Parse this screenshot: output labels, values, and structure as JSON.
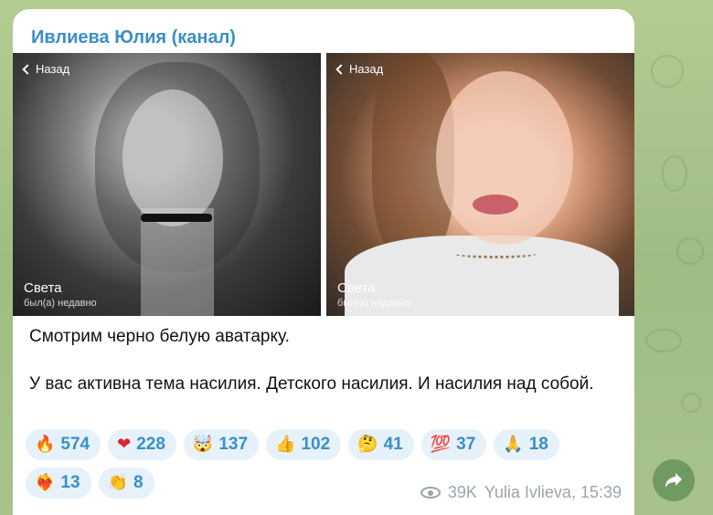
{
  "channel": {
    "name": "Ивлиева Юлия (канал)"
  },
  "photos": [
    {
      "back_label": "Назад",
      "contact_name": "Света",
      "contact_status": "был(а) недавно"
    },
    {
      "back_label": "Назад",
      "contact_name": "Света",
      "contact_status": "был(а) недавно"
    }
  ],
  "message": {
    "paragraphs": [
      "Смотрим черно белую аватарку.",
      "У вас активна тема насилия. Детского насилия. И насилия над собой."
    ]
  },
  "reactions": [
    {
      "emoji": "🔥",
      "icon": "fire-icon",
      "count": "574"
    },
    {
      "emoji": "❤",
      "icon": "heart-icon",
      "count": "228"
    },
    {
      "emoji": "🤯",
      "icon": "exploding-head-icon",
      "count": "137"
    },
    {
      "emoji": "👍",
      "icon": "thumbs-up-icon",
      "count": "102"
    },
    {
      "emoji": "🤔",
      "icon": "thinking-face-icon",
      "count": "41"
    },
    {
      "emoji": "💯",
      "icon": "hundred-icon",
      "count": "37"
    },
    {
      "emoji": "🙏",
      "icon": "folded-hands-icon",
      "count": "18"
    },
    {
      "emoji": "❤‍🔥",
      "icon": "heart-on-fire-icon",
      "count": "13"
    },
    {
      "emoji": "👏",
      "icon": "clapping-hands-icon",
      "count": "8"
    }
  ],
  "meta": {
    "views": "39K",
    "author_time": "Yulia Ivlieva, 15:39"
  },
  "colors": {
    "accent": "#3a8fc8",
    "reaction_bg": "#e6f1fa",
    "share_button": "#6f9b63"
  }
}
